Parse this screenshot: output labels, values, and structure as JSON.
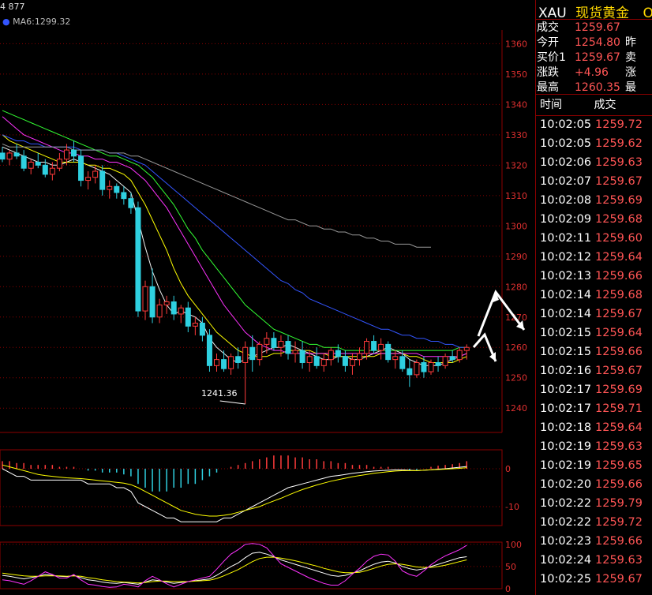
{
  "chart_header": {
    "left_label": "4 877",
    "ma_label": "MA6:1299.32"
  },
  "quote": {
    "symbol": "XAU",
    "name": "现货黄金",
    "name_suffix": "O",
    "rows": [
      {
        "k": "成交",
        "v": "1259.67",
        "k2": ""
      },
      {
        "k": "今开",
        "v": "1254.80",
        "k2": "昨"
      },
      {
        "k": "买价1",
        "v": "1259.67",
        "k2": "卖"
      },
      {
        "k": "涨跌",
        "v": "+4.96",
        "k2": "涨"
      },
      {
        "k": "最高",
        "v": "1260.35",
        "k2": "最"
      }
    ]
  },
  "ticks": {
    "headers": [
      "时间",
      "成交"
    ],
    "rows": [
      [
        "10:02:05",
        "1259.72"
      ],
      [
        "10:02:05",
        "1259.62"
      ],
      [
        "10:02:06",
        "1259.63"
      ],
      [
        "10:02:07",
        "1259.67"
      ],
      [
        "10:02:08",
        "1259.69"
      ],
      [
        "10:02:09",
        "1259.68"
      ],
      [
        "10:02:11",
        "1259.60"
      ],
      [
        "10:02:12",
        "1259.64"
      ],
      [
        "10:02:13",
        "1259.66"
      ],
      [
        "10:02:14",
        "1259.68"
      ],
      [
        "10:02:14",
        "1259.67"
      ],
      [
        "10:02:15",
        "1259.64"
      ],
      [
        "10:02:15",
        "1259.66"
      ],
      [
        "10:02:16",
        "1259.67"
      ],
      [
        "10:02:17",
        "1259.69"
      ],
      [
        "10:02:17",
        "1259.71"
      ],
      [
        "10:02:18",
        "1259.64"
      ],
      [
        "10:02:19",
        "1259.63"
      ],
      [
        "10:02:19",
        "1259.65"
      ],
      [
        "10:02:20",
        "1259.66"
      ],
      [
        "10:02:22",
        "1259.79"
      ],
      [
        "10:02:22",
        "1259.72"
      ],
      [
        "10:02:23",
        "1259.66"
      ],
      [
        "10:02:24",
        "1259.63"
      ],
      [
        "10:02:25",
        "1259.67"
      ]
    ]
  },
  "chart_data": {
    "type": "candlestick",
    "price_axis": {
      "ylim": [
        1232,
        1364
      ],
      "ticks": [
        1360,
        1350,
        1340,
        1330,
        1320,
        1310,
        1300,
        1290,
        1280,
        1270,
        1260,
        1250,
        1240
      ]
    },
    "low_annotation": "1241.36",
    "macd_axis": {
      "ylim": [
        -15,
        5
      ],
      "ticks": [
        0,
        -10
      ]
    },
    "kdj_axis": {
      "ylim": [
        0,
        105
      ],
      "ticks": [
        100,
        50,
        0
      ]
    },
    "colors": {
      "up": "#ff3b3b",
      "down": "#2fd0e0",
      "ma5": "#f0f0f0",
      "ma10": "#ffff00",
      "ma20": "#ff33ff",
      "ma30": "#33ff33",
      "ma60": "#3355ff",
      "ma120": "#999999",
      "grid": "#8b0000",
      "axis_text": "#e03030"
    },
    "candles": [
      [
        1324,
        1326,
        1321,
        1322
      ],
      [
        1322,
        1325,
        1320,
        1324
      ],
      [
        1324,
        1327,
        1322,
        1323
      ],
      [
        1323,
        1325,
        1318,
        1319
      ],
      [
        1319,
        1322,
        1317,
        1321
      ],
      [
        1321,
        1324,
        1319,
        1320
      ],
      [
        1320,
        1322,
        1316,
        1317
      ],
      [
        1317,
        1321,
        1315,
        1319
      ],
      [
        1319,
        1324,
        1318,
        1322
      ],
      [
        1322,
        1327,
        1320,
        1325
      ],
      [
        1325,
        1328,
        1321,
        1323
      ],
      [
        1323,
        1325,
        1313,
        1315
      ],
      [
        1315,
        1318,
        1312,
        1316
      ],
      [
        1316,
        1320,
        1314,
        1318
      ],
      [
        1318,
        1320,
        1310,
        1312
      ],
      [
        1312,
        1315,
        1309,
        1313
      ],
      [
        1313,
        1314,
        1309,
        1311
      ],
      [
        1311,
        1313,
        1307,
        1309
      ],
      [
        1309,
        1311,
        1304,
        1306
      ],
      [
        1306,
        1308,
        1270,
        1272
      ],
      [
        1272,
        1282,
        1269,
        1280
      ],
      [
        1280,
        1286,
        1268,
        1270
      ],
      [
        1270,
        1276,
        1268,
        1274
      ],
      [
        1274,
        1277,
        1271,
        1275
      ],
      [
        1275,
        1277,
        1269,
        1271
      ],
      [
        1271,
        1274,
        1268,
        1273
      ],
      [
        1273,
        1275,
        1265,
        1267
      ],
      [
        1267,
        1270,
        1264,
        1268
      ],
      [
        1268,
        1270,
        1262,
        1264
      ],
      [
        1264,
        1266,
        1252,
        1254
      ],
      [
        1254,
        1258,
        1252,
        1256
      ],
      [
        1256,
        1259,
        1252,
        1253
      ],
      [
        1253,
        1258,
        1251,
        1257
      ],
      [
        1257,
        1260,
        1253,
        1255
      ],
      [
        1255,
        1262,
        1241.36,
        1260
      ],
      [
        1260,
        1264,
        1252,
        1256
      ],
      [
        1256,
        1262,
        1254,
        1261
      ],
      [
        1261,
        1265,
        1258,
        1263
      ],
      [
        1263,
        1265,
        1259,
        1260
      ],
      [
        1260,
        1264,
        1257,
        1262
      ],
      [
        1262,
        1264,
        1256,
        1258
      ],
      [
        1258,
        1262,
        1255,
        1259
      ],
      [
        1259,
        1262,
        1253,
        1255
      ],
      [
        1255,
        1259,
        1252,
        1257
      ],
      [
        1257,
        1260,
        1253,
        1254
      ],
      [
        1254,
        1258,
        1252,
        1256
      ],
      [
        1256,
        1260,
        1254,
        1259
      ],
      [
        1259,
        1261,
        1255,
        1257
      ],
      [
        1257,
        1259,
        1252,
        1254
      ],
      [
        1254,
        1258,
        1251,
        1256
      ],
      [
        1256,
        1260,
        1254,
        1258
      ],
      [
        1258,
        1263,
        1256,
        1262
      ],
      [
        1262,
        1264,
        1258,
        1259
      ],
      [
        1259,
        1263,
        1256,
        1261
      ],
      [
        1261,
        1262,
        1255,
        1256
      ],
      [
        1256,
        1259,
        1253,
        1257
      ],
      [
        1257,
        1259,
        1252,
        1253
      ],
      [
        1253,
        1256,
        1247,
        1251
      ],
      [
        1251,
        1256,
        1250,
        1255
      ],
      [
        1255,
        1257,
        1250,
        1252
      ],
      [
        1252,
        1256,
        1251,
        1255
      ],
      [
        1255,
        1257,
        1252,
        1254
      ],
      [
        1254,
        1258,
        1253,
        1257
      ],
      [
        1257,
        1259,
        1255,
        1256
      ],
      [
        1256,
        1260,
        1255,
        1259
      ],
      [
        1259,
        1261,
        1256,
        1260
      ]
    ],
    "ma_lines": {
      "ma5": [
        1326,
        1325,
        1324,
        1323,
        1322,
        1321,
        1321,
        1320,
        1320,
        1321,
        1322,
        1321,
        1320,
        1319,
        1318,
        1317,
        1315,
        1313,
        1311,
        1302,
        1293,
        1285,
        1279,
        1274,
        1271,
        1272,
        1271,
        1270,
        1268,
        1263,
        1260,
        1258,
        1256,
        1255,
        1256,
        1257,
        1258,
        1259,
        1260,
        1260,
        1261,
        1260,
        1259,
        1258,
        1257,
        1256,
        1256,
        1257,
        1257,
        1256,
        1256,
        1257,
        1258,
        1259,
        1260,
        1259,
        1258,
        1256,
        1255,
        1254,
        1254,
        1254,
        1255,
        1256,
        1257,
        1258
      ],
      "ma10": [
        1330,
        1328,
        1327,
        1326,
        1325,
        1324,
        1323,
        1322,
        1321,
        1321,
        1321,
        1321,
        1320,
        1320,
        1319,
        1319,
        1318,
        1317,
        1315,
        1311,
        1307,
        1302,
        1297,
        1292,
        1286,
        1281,
        1277,
        1274,
        1271,
        1268,
        1265,
        1263,
        1261,
        1259,
        1258,
        1257,
        1257,
        1257,
        1258,
        1258,
        1259,
        1259,
        1259,
        1259,
        1258,
        1258,
        1257,
        1257,
        1257,
        1257,
        1257,
        1257,
        1257,
        1258,
        1258,
        1258,
        1258,
        1257,
        1257,
        1256,
        1255,
        1255,
        1255,
        1255,
        1256,
        1257
      ],
      "ma20": [
        1336,
        1334,
        1332,
        1330,
        1329,
        1328,
        1327,
        1326,
        1325,
        1324,
        1324,
        1323,
        1323,
        1322,
        1322,
        1321,
        1321,
        1320,
        1319,
        1317,
        1315,
        1312,
        1309,
        1306,
        1302,
        1298,
        1294,
        1290,
        1286,
        1282,
        1278,
        1274,
        1271,
        1268,
        1265,
        1263,
        1261,
        1260,
        1259,
        1259,
        1258,
        1258,
        1258,
        1258,
        1258,
        1258,
        1258,
        1258,
        1258,
        1258,
        1258,
        1258,
        1258,
        1258,
        1258,
        1258,
        1258,
        1258,
        1258,
        1257,
        1257,
        1257,
        1257,
        1257,
        1257,
        1258
      ],
      "ma30": [
        1338,
        1337,
        1336,
        1335,
        1334,
        1333,
        1332,
        1331,
        1330,
        1329,
        1328,
        1327,
        1326,
        1325,
        1324,
        1323,
        1323,
        1322,
        1321,
        1320,
        1318,
        1316,
        1313,
        1310,
        1307,
        1303,
        1299,
        1296,
        1292,
        1289,
        1286,
        1283,
        1280,
        1277,
        1274,
        1272,
        1270,
        1268,
        1266,
        1265,
        1264,
        1263,
        1262,
        1261,
        1261,
        1260,
        1260,
        1260,
        1259,
        1259,
        1259,
        1259,
        1259,
        1259,
        1259,
        1259,
        1259,
        1259,
        1259,
        1259,
        1259,
        1259,
        1259,
        1259,
        1260,
        1260
      ],
      "ma60": [
        1330,
        1329,
        1328,
        1328,
        1327,
        1327,
        1326,
        1326,
        1326,
        1326,
        1326,
        1325,
        1325,
        1325,
        1325,
        1324,
        1324,
        1323,
        1322,
        1321,
        1320,
        1318,
        1316,
        1314,
        1312,
        1310,
        1308,
        1306,
        1304,
        1302,
        1300,
        1298,
        1296,
        1294,
        1292,
        1290,
        1288,
        1286,
        1284,
        1282,
        1281,
        1279,
        1278,
        1276,
        1275,
        1274,
        1273,
        1272,
        1271,
        1270,
        1269,
        1268,
        1267,
        1266,
        1266,
        1265,
        1264,
        1264,
        1263,
        1263,
        1262,
        1262,
        1261,
        1261,
        1260,
        1260
      ],
      "ma120": [
        1327,
        1326,
        1326,
        1326,
        1326,
        1326,
        1326,
        1326,
        1326,
        1326,
        1325,
        1325,
        1325,
        1325,
        1325,
        1324,
        1324,
        1324,
        1323,
        1323,
        1322,
        1321,
        1320,
        1319,
        1318,
        1317,
        1316,
        1315,
        1314,
        1313,
        1312,
        1311,
        1310,
        1309,
        1308,
        1307,
        1306,
        1305,
        1304,
        1303,
        1302,
        1302,
        1301,
        1300,
        1300,
        1299,
        1299,
        1298,
        1298,
        1297,
        1297,
        1296,
        1296,
        1295,
        1295,
        1294,
        1294,
        1294,
        1293,
        1293,
        1293,
        null,
        null,
        null,
        null,
        null
      ]
    },
    "macd_hist": [
      2,
      2,
      1.5,
      1.5,
      1,
      1,
      1,
      1,
      0.5,
      0.5,
      0.5,
      0,
      -0.5,
      -0.5,
      -1,
      -1,
      -1,
      -1.5,
      -2,
      -4,
      -5,
      -6,
      -6,
      -6,
      -5,
      -5,
      -4,
      -4,
      -3,
      -2,
      -1,
      0,
      0.5,
      1,
      1.5,
      2,
      2.5,
      3,
      3.5,
      3.5,
      3.5,
      3,
      3,
      2.5,
      2.5,
      2,
      2,
      1.5,
      1.5,
      1,
      1,
      1,
      0.5,
      0.5,
      0.5,
      0,
      0,
      -0.3,
      -0.3,
      0,
      0.5,
      0.8,
      1,
      1.2,
      1.5,
      2
    ],
    "macd_dif": [
      0,
      -1,
      -2,
      -2,
      -3,
      -3,
      -3,
      -3,
      -3,
      -3,
      -3,
      -3,
      -4,
      -4,
      -4,
      -4,
      -5,
      -5,
      -6,
      -9,
      -10,
      -11,
      -12,
      -13,
      -13,
      -14,
      -14,
      -14,
      -14,
      -14,
      -14,
      -13,
      -13,
      -12,
      -11,
      -10,
      -9,
      -8,
      -7,
      -6,
      -5,
      -4.5,
      -4,
      -3.5,
      -3,
      -2.5,
      -2,
      -1.8,
      -1.5,
      -1.2,
      -1,
      -0.8,
      -0.6,
      -0.5,
      -0.4,
      -0.3,
      -0.3,
      -0.4,
      -0.5,
      -0.4,
      -0.3,
      -0.1,
      0,
      0.2,
      0.4,
      0.6
    ],
    "macd_dea": [
      1,
      0.5,
      0,
      -0.5,
      -1,
      -1.5,
      -1.8,
      -2,
      -2.2,
      -2.4,
      -2.5,
      -2.6,
      -2.8,
      -3,
      -3.2,
      -3.4,
      -3.6,
      -3.8,
      -4.2,
      -5,
      -6,
      -7,
      -8,
      -9,
      -10,
      -11,
      -11.5,
      -12,
      -12.3,
      -12.5,
      -12.5,
      -12.3,
      -12,
      -11.5,
      -11,
      -10.5,
      -10,
      -9.2,
      -8.5,
      -7.8,
      -7,
      -6.2,
      -5.5,
      -4.9,
      -4.3,
      -3.8,
      -3.3,
      -2.9,
      -2.5,
      -2.1,
      -1.8,
      -1.5,
      -1.2,
      -1,
      -0.8,
      -0.6,
      -0.5,
      -0.5,
      -0.5,
      -0.4,
      -0.3,
      -0.2,
      -0.1,
      0,
      0.1,
      0.3
    ],
    "kdj_k": [
      30,
      28,
      25,
      22,
      25,
      28,
      32,
      30,
      28,
      27,
      30,
      25,
      20,
      18,
      15,
      13,
      12,
      14,
      12,
      10,
      15,
      20,
      18,
      15,
      12,
      14,
      16,
      18,
      20,
      22,
      30,
      40,
      50,
      58,
      70,
      80,
      82,
      78,
      72,
      65,
      60,
      55,
      50,
      45,
      40,
      35,
      30,
      28,
      30,
      35,
      40,
      48,
      55,
      60,
      62,
      58,
      50,
      45,
      42,
      45,
      50,
      55,
      60,
      65,
      70,
      72
    ],
    "kdj_d": [
      35,
      33,
      31,
      29,
      28,
      28,
      29,
      29,
      29,
      28,
      29,
      28,
      25,
      23,
      20,
      18,
      16,
      15,
      14,
      13,
      14,
      16,
      17,
      17,
      16,
      16,
      16,
      17,
      18,
      19,
      23,
      29,
      36,
      43,
      52,
      61,
      68,
      71,
      71,
      69,
      66,
      63,
      59,
      55,
      51,
      46,
      42,
      38,
      36,
      36,
      37,
      41,
      46,
      51,
      55,
      56,
      55,
      52,
      49,
      48,
      48,
      50,
      53,
      57,
      61,
      65
    ],
    "kdj_j": [
      20,
      18,
      14,
      10,
      18,
      28,
      38,
      32,
      24,
      24,
      32,
      20,
      10,
      8,
      5,
      3,
      4,
      10,
      8,
      4,
      18,
      28,
      20,
      11,
      4,
      10,
      16,
      20,
      24,
      28,
      44,
      62,
      78,
      88,
      100,
      102,
      100,
      92,
      74,
      56,
      48,
      40,
      32,
      24,
      18,
      12,
      8,
      8,
      18,
      33,
      46,
      62,
      73,
      78,
      76,
      62,
      40,
      32,
      28,
      40,
      54,
      65,
      74,
      81,
      88,
      98
    ]
  }
}
